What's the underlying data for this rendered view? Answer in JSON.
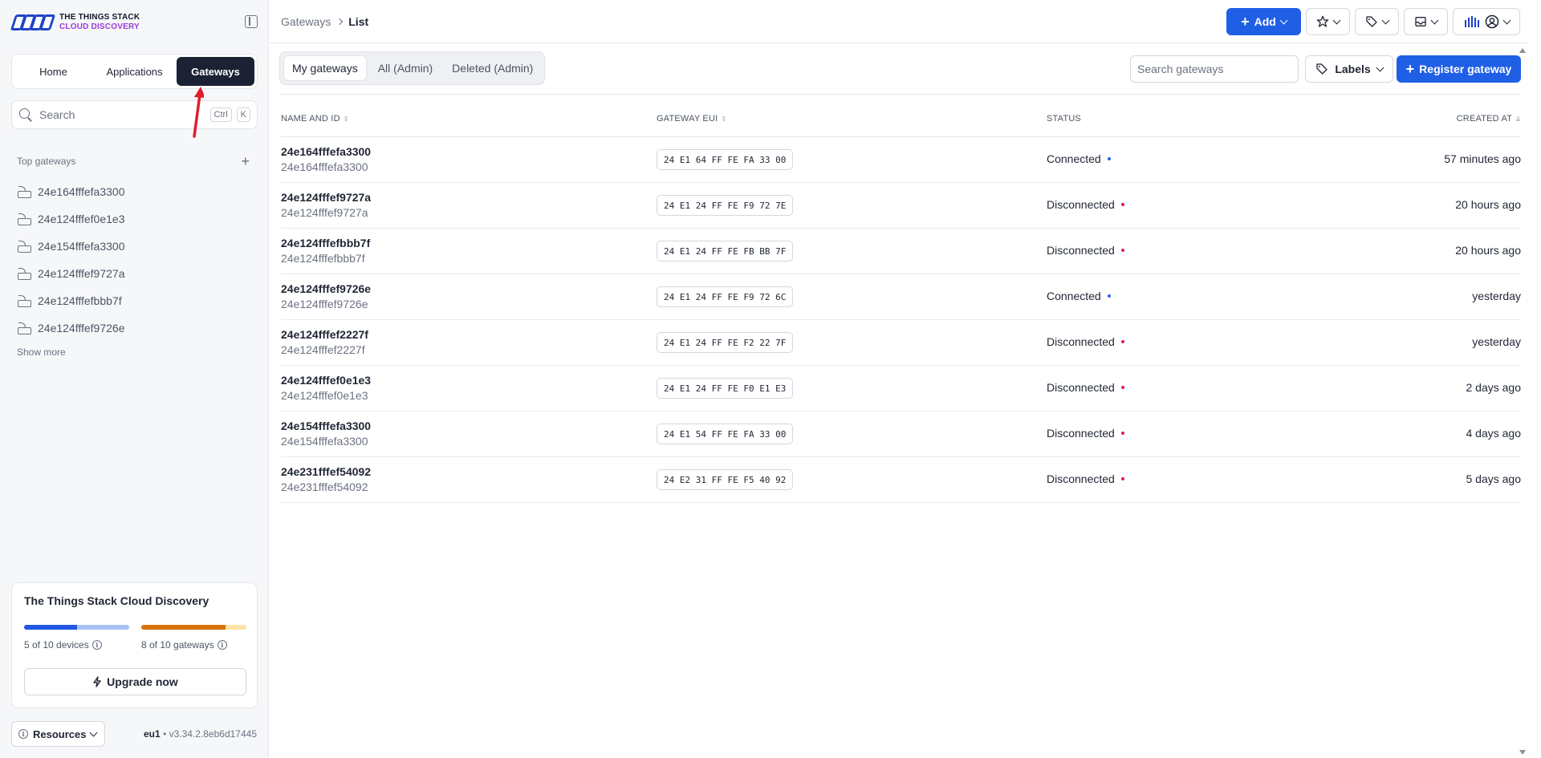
{
  "brand": {
    "line1": "THE THINGS STACK",
    "line2": "CLOUD DISCOVERY"
  },
  "nav": {
    "tabs": [
      "Home",
      "Applications",
      "Gateways"
    ],
    "active": "Gateways"
  },
  "sidebar_search": {
    "placeholder": "Search",
    "shortcut": [
      "Ctrl",
      "K"
    ]
  },
  "top_gateways": {
    "heading": "Top gateways",
    "items": [
      "24e164fffefa3300",
      "24e124fffef0e1e3",
      "24e154fffefa3300",
      "24e124fffef9727a",
      "24e124fffefbbb7f",
      "24e124fffef9726e"
    ],
    "show_more": "Show more"
  },
  "plan": {
    "title": "The Things Stack Cloud Discovery",
    "devices_label": "5 of 10 devices",
    "devices_fraction": 0.5,
    "gateways_label": "8 of 10 gateways",
    "gateways_fraction": 0.8,
    "upgrade_label": "Upgrade now"
  },
  "footer": {
    "resources_label": "Resources",
    "region": "eu1",
    "version": "v3.34.2.8eb6d17445"
  },
  "breadcrumb": {
    "parent": "Gateways",
    "current": "List"
  },
  "topbar": {
    "add_label": "Add"
  },
  "filters": {
    "tabs": [
      "My gateways",
      "All (Admin)",
      "Deleted (Admin)"
    ],
    "active": "My gateways",
    "search_placeholder": "Search gateways",
    "labels_label": "Labels",
    "register_label": "Register gateway"
  },
  "table": {
    "columns": [
      "NAME AND ID",
      "GATEWAY EUI",
      "STATUS",
      "CREATED AT"
    ],
    "rows": [
      {
        "name": "24e164fffefa3300",
        "id": "24e164fffefa3300",
        "eui": "24 E1 64 FF FE FA 33 00",
        "status": "Connected",
        "created": "57 minutes ago"
      },
      {
        "name": "24e124fffef9727a",
        "id": "24e124fffef9727a",
        "eui": "24 E1 24 FF FE F9 72 7E",
        "status": "Disconnected",
        "created": "20 hours ago"
      },
      {
        "name": "24e124fffefbbb7f",
        "id": "24e124fffefbbb7f",
        "eui": "24 E1 24 FF FE FB BB 7F",
        "status": "Disconnected",
        "created": "20 hours ago"
      },
      {
        "name": "24e124fffef9726e",
        "id": "24e124fffef9726e",
        "eui": "24 E1 24 FF FE F9 72 6C",
        "status": "Connected",
        "created": "yesterday"
      },
      {
        "name": "24e124fffef2227f",
        "id": "24e124fffef2227f",
        "eui": "24 E1 24 FF FE F2 22 7F",
        "status": "Disconnected",
        "created": "yesterday"
      },
      {
        "name": "24e124fffef0e1e3",
        "id": "24e124fffef0e1e3",
        "eui": "24 E1 24 FF FE F0 E1 E3",
        "status": "Disconnected",
        "created": "2 days ago"
      },
      {
        "name": "24e154fffefa3300",
        "id": "24e154fffefa3300",
        "eui": "24 E1 54 FF FE FA 33 00",
        "status": "Disconnected",
        "created": "4 days ago"
      },
      {
        "name": "24e231fffef54092",
        "id": "24e231fffef54092",
        "eui": "24 E2 31 FF FE F5 40 92",
        "status": "Disconnected",
        "created": "5 days ago"
      }
    ]
  },
  "colors": {
    "primary": "#1f5fe6",
    "connected": "#2563eb",
    "disconnected": "#e11d48",
    "nav_active_bg": "#1a2233",
    "annotation_arrow": "#e01e2b"
  }
}
